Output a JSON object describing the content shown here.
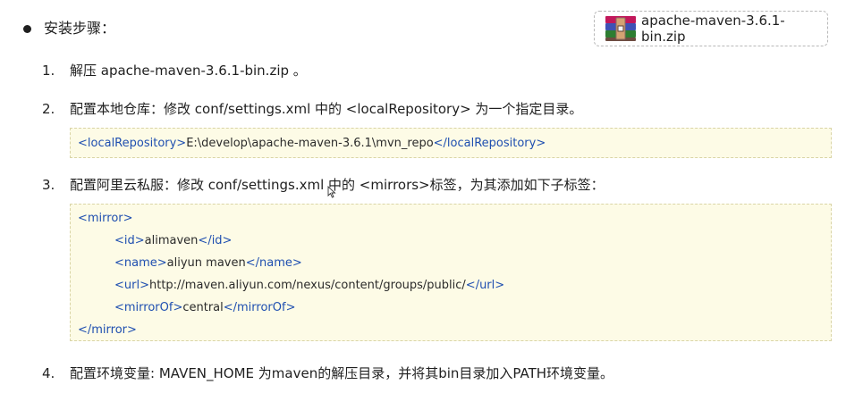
{
  "heading": "安装步骤：",
  "file_chip": {
    "filename": "apache-maven-3.6.1-bin.zip",
    "icon": "winrar-archive-icon"
  },
  "steps": [
    {
      "num": "1.",
      "text": "解压 apache-maven-3.6.1-bin.zip 。"
    },
    {
      "num": "2.",
      "text": "配置本地仓库：修改 conf/settings.xml 中的 <localRepository> 为一个指定目录。"
    },
    {
      "num": "3.",
      "text": "配置阿里云私服：修改 conf/settings.xml 中的 <mirrors>标签，为其添加如下子标签："
    },
    {
      "num": "4.",
      "text": "配置环境变量: MAVEN_HOME 为maven的解压目录，并将其bin目录加入PATH环境变量。"
    }
  ],
  "code_local_repo": {
    "open": "<localRepository>",
    "value": "E:\\develop\\apache-maven-3.6.1\\mvn_repo",
    "close": "</localRepository>"
  },
  "code_mirror": {
    "open": "<mirror>",
    "close": "</mirror>",
    "children": [
      {
        "open": "<id>",
        "value": "alimaven",
        "close": "</id>"
      },
      {
        "open": "<name>",
        "value": "aliyun maven",
        "close": "</name>"
      },
      {
        "open": "<url>",
        "value": "http://maven.aliyun.com/nexus/content/groups/public/",
        "close": "</url>"
      },
      {
        "open": "<mirrorOf>",
        "value": "central",
        "close": "</mirrorOf>"
      }
    ]
  },
  "colors": {
    "tag": "#1f4fb0",
    "code_bg": "#fdfbe6",
    "text": "#1f1f1f"
  }
}
